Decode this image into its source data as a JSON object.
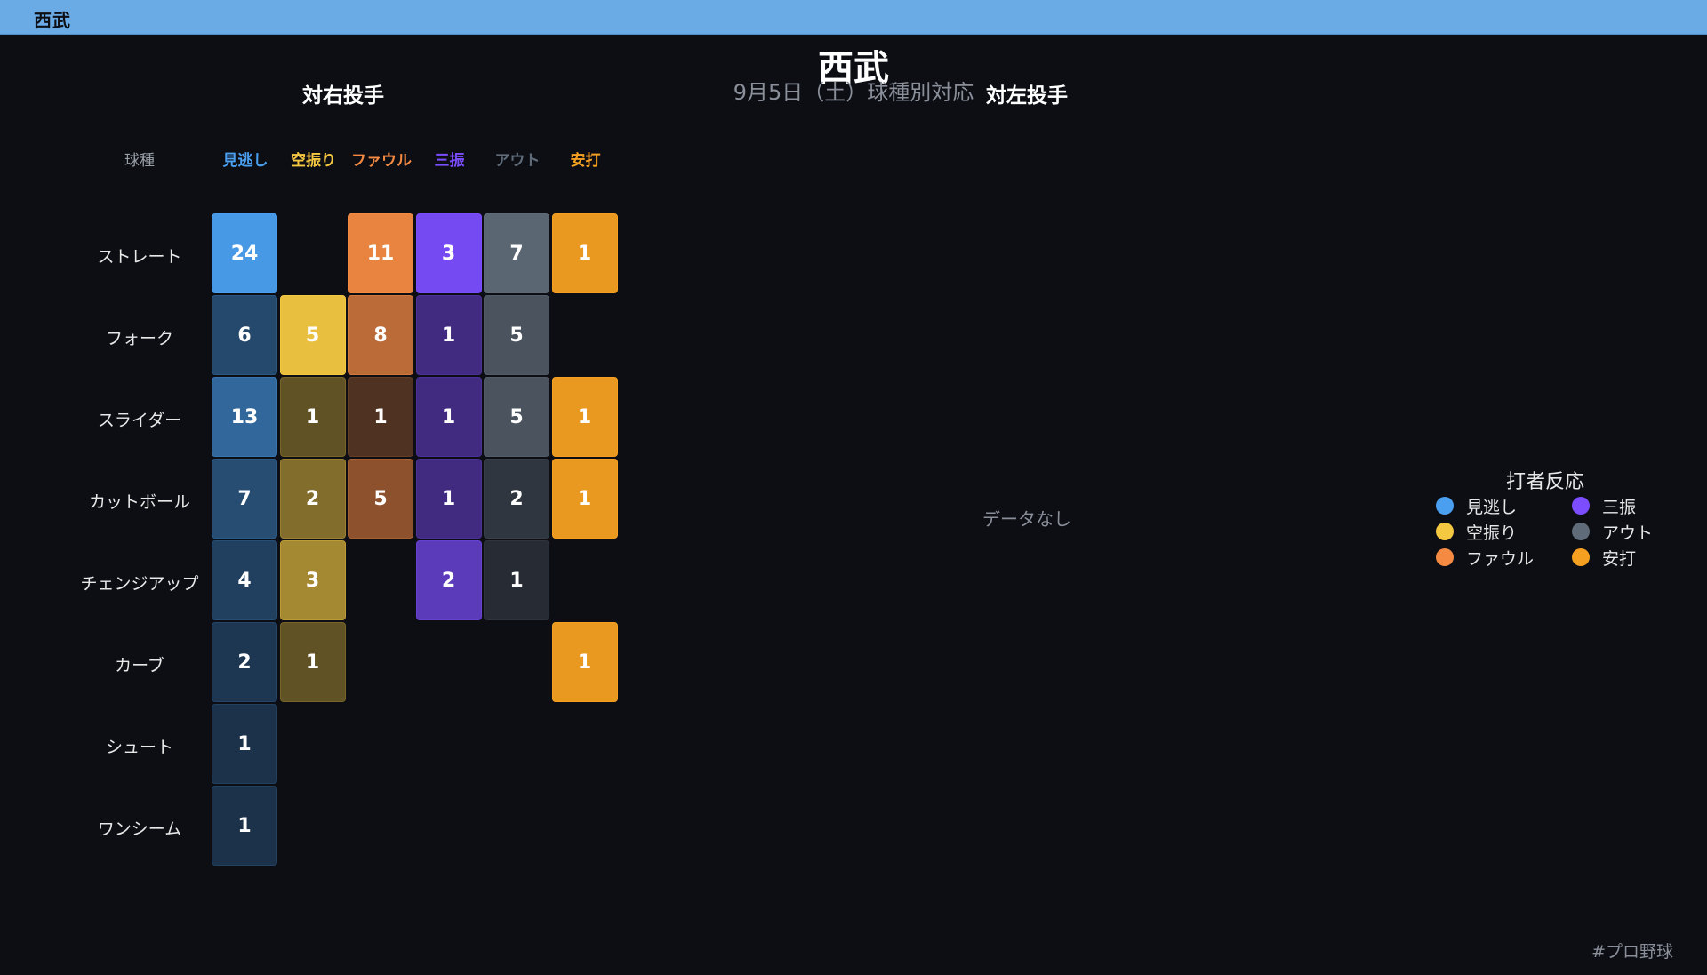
{
  "header": {
    "team": "西武"
  },
  "title": "西武",
  "subtitle": "9月5日（土）球種別対応",
  "right_pitcher_title": "対右投手",
  "left_pitcher_title": "対左投手",
  "pitch_column_label": "球種",
  "no_data_text": "データなし",
  "hashtag": "#プロ野球",
  "chart_data": {
    "type": "heatmap",
    "columns": [
      {
        "key": "miss",
        "label": "見逃し",
        "color": "#4a9ff0"
      },
      {
        "key": "whiff",
        "label": "空振り",
        "color": "#f5c842"
      },
      {
        "key": "foul",
        "label": "ファウル",
        "color": "#f58a42"
      },
      {
        "key": "k",
        "label": "三振",
        "color": "#7c4dff"
      },
      {
        "key": "out",
        "label": "アウト",
        "color": "#5f6b78"
      },
      {
        "key": "hit",
        "label": "安打",
        "color": "#f5a020"
      }
    ],
    "rows": [
      {
        "pitch": "ストレート",
        "values": [
          24,
          null,
          11,
          3,
          7,
          1
        ]
      },
      {
        "pitch": "フォーク",
        "values": [
          6,
          5,
          8,
          1,
          5,
          null
        ]
      },
      {
        "pitch": "スライダー",
        "values": [
          13,
          1,
          1,
          1,
          5,
          1
        ]
      },
      {
        "pitch": "カットボール",
        "values": [
          7,
          2,
          5,
          1,
          2,
          1
        ]
      },
      {
        "pitch": "チェンジアップ",
        "values": [
          4,
          3,
          null,
          2,
          1,
          null
        ]
      },
      {
        "pitch": "カーブ",
        "values": [
          2,
          1,
          null,
          null,
          null,
          1
        ]
      },
      {
        "pitch": "シュート",
        "values": [
          1,
          null,
          null,
          null,
          null,
          null
        ]
      },
      {
        "pitch": "ワンシーム",
        "values": [
          1,
          null,
          null,
          null,
          null,
          null
        ]
      }
    ],
    "legend_title": "打者反応",
    "legend": [
      {
        "label": "見逃し",
        "color": "#4a9ff0"
      },
      {
        "label": "三振",
        "color": "#7c4dff"
      },
      {
        "label": "空振り",
        "color": "#f5c842"
      },
      {
        "label": "アウト",
        "color": "#5f6b78"
      },
      {
        "label": "ファウル",
        "color": "#f58a42"
      },
      {
        "label": "安打",
        "color": "#f5a020"
      }
    ]
  }
}
